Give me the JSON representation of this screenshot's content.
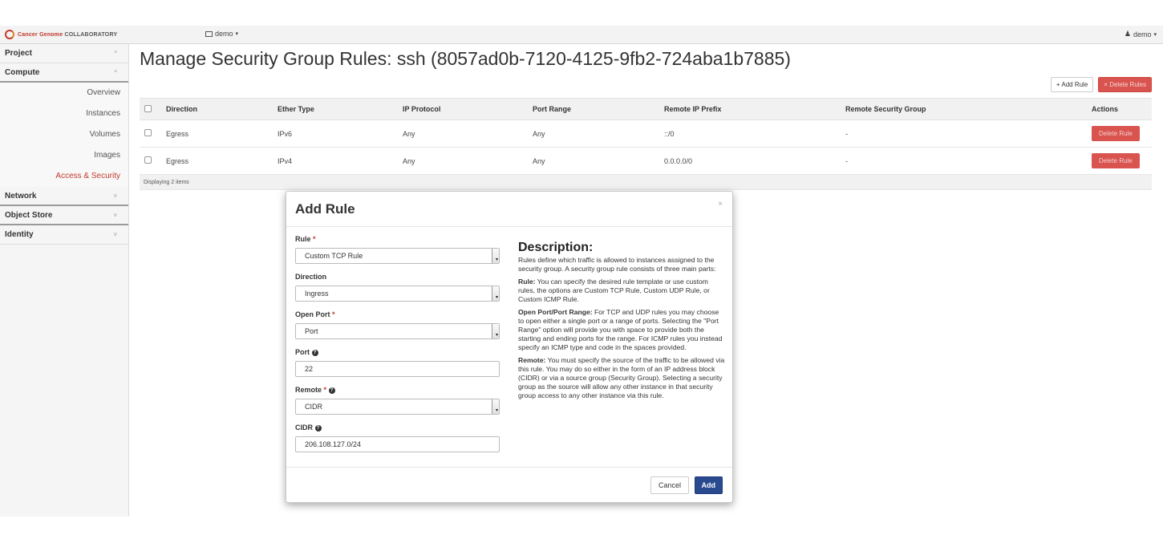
{
  "topbar": {
    "brand_red": "Cancer Genome",
    "brand_rest": "COLLABORATORY",
    "project_label": "demo",
    "user_label": "demo"
  },
  "sidebar": {
    "sections": [
      {
        "label": "Project",
        "chevron": "^"
      },
      {
        "label": "Compute",
        "chevron": "^"
      }
    ],
    "compute_items": [
      "Overview",
      "Instances",
      "Volumes",
      "Images",
      "Access & Security"
    ],
    "active_item": "Access & Security",
    "collapsed_sections": [
      {
        "label": "Network",
        "chevron": "˅"
      },
      {
        "label": "Object Store",
        "chevron": "˅"
      },
      {
        "label": "Identity",
        "chevron": "˅"
      }
    ]
  },
  "main": {
    "title": "Manage Security Group Rules: ssh (8057ad0b-7120-4125-9fb2-724aba1b7885)",
    "add_rule_label": "+ Add Rule",
    "delete_rules_label": "× Delete Rules"
  },
  "table": {
    "columns": [
      "Direction",
      "Ether Type",
      "IP Protocol",
      "Port Range",
      "Remote IP Prefix",
      "Remote Security Group",
      "Actions"
    ],
    "rows": [
      {
        "direction": "Egress",
        "ether_type": "IPv6",
        "ip_protocol": "Any",
        "port_range": "Any",
        "remote_ip_prefix": "::/0",
        "remote_security_group": "-",
        "action": "Delete Rule"
      },
      {
        "direction": "Egress",
        "ether_type": "IPv4",
        "ip_protocol": "Any",
        "port_range": "Any",
        "remote_ip_prefix": "0.0.0.0/0",
        "remote_security_group": "-",
        "action": "Delete Rule"
      }
    ],
    "footer": "Displaying 2 items"
  },
  "modal": {
    "title": "Add Rule",
    "close": "×",
    "fields": {
      "rule_label": "Rule",
      "rule_value": "Custom TCP Rule",
      "direction_label": "Direction",
      "direction_value": "Ingress",
      "open_port_label": "Open Port",
      "open_port_value": "Port",
      "port_label": "Port",
      "port_value": "22",
      "remote_label": "Remote",
      "remote_value": "CIDR",
      "cidr_label": "CIDR",
      "cidr_value": "206.108.127.0/24",
      "required_marker": "*",
      "help_icon": "?"
    },
    "description": {
      "title": "Description:",
      "intro": "Rules define which traffic is allowed to instances assigned to the security group. A security group rule consists of three main parts:",
      "rule_term": "Rule:",
      "rule_text": " You can specify the desired rule template or use custom rules, the options are Custom TCP Rule, Custom UDP Rule, or Custom ICMP Rule.",
      "port_term": "Open Port/Port Range:",
      "port_text": " For TCP and UDP rules you may choose to open either a single port or a range of ports. Selecting the \"Port Range\" option will provide you with space to provide both the starting and ending ports for the range. For ICMP rules you instead specify an ICMP type and code in the spaces provided.",
      "remote_term": "Remote:",
      "remote_text": " You must specify the source of the traffic to be allowed via this rule. You may do so either in the form of an IP address block (CIDR) or via a source group (Security Group). Selecting a security group as the source will allow any other instance in that security group access to any other instance via this rule."
    },
    "cancel_label": "Cancel",
    "add_label": "Add"
  },
  "colors": {
    "danger": "#d9534f",
    "primary": "#2a4a8f",
    "active_nav": "#c0392b"
  }
}
